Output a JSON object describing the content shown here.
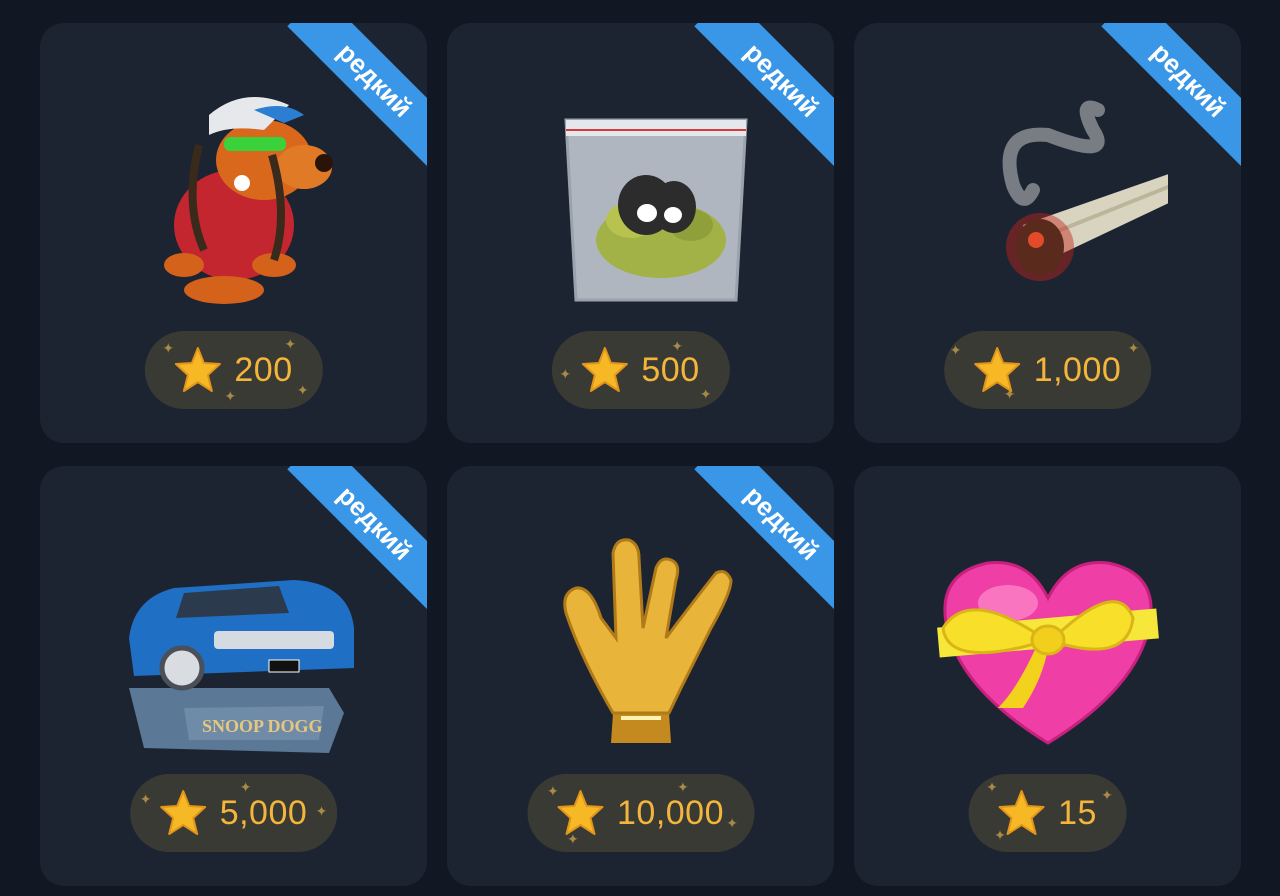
{
  "colors": {
    "background": "#121823",
    "card": "#1c2431",
    "ribbon": "#3a97e8",
    "price_pill": "#3a3a35",
    "price_text": "#f4b53b"
  },
  "currency_icon": "star-icon",
  "gifts": [
    {
      "item": "snoop-dog-character",
      "badge": "редкий",
      "price": "200"
    },
    {
      "item": "weed-bag",
      "badge": "редкий",
      "price": "500"
    },
    {
      "item": "joint",
      "badge": "редкий",
      "price": "1,000"
    },
    {
      "item": "blue-cadillac-car",
      "badge": "редкий",
      "price": "5,000"
    },
    {
      "item": "golden-hand-sign",
      "badge": "редкий",
      "price": "10,000"
    },
    {
      "item": "heart-with-bow",
      "badge": null,
      "price": "15"
    }
  ]
}
